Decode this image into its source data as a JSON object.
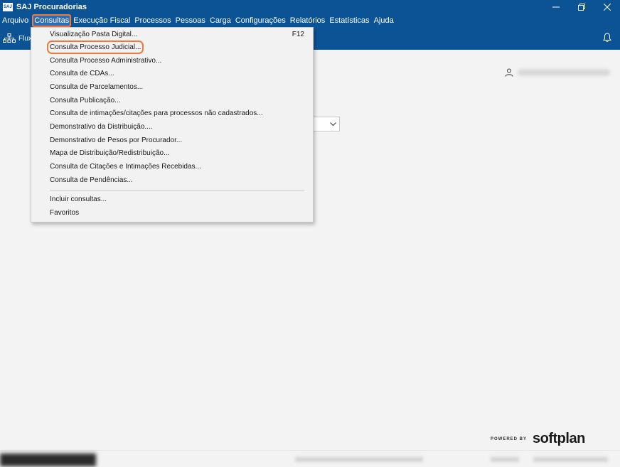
{
  "window": {
    "logo": "SAJ",
    "title": "SAJ Procuradorias"
  },
  "menubar": {
    "items": [
      "Arquivo",
      "Consultas",
      "Execução Fiscal",
      "Processos",
      "Pessoas",
      "Carga",
      "Configurações",
      "Relatórios",
      "Estatísticas",
      "Ajuda"
    ],
    "active_index": 1
  },
  "toolbar": {
    "first_item": "Flux",
    "icons": [
      "sitemap-icon",
      "bell-icon"
    ]
  },
  "consultas_menu": {
    "items": [
      {
        "label": "Visualização Pasta Digital...",
        "shortcut": "F12"
      },
      {
        "label": "Consulta Processo Judicial...",
        "highlighted": true
      },
      {
        "label": "Consulta Processo Administrativo..."
      },
      {
        "label": "Consulta de CDAs..."
      },
      {
        "label": "Consulta de Parcelamentos..."
      },
      {
        "label": "Consulta Publicação..."
      },
      {
        "label": "Consulta de intimações/citações para processos não cadastrados..."
      },
      {
        "label": "Demonstrativo da Distribuição...."
      },
      {
        "label": "Demonstrativo de Pesos por Procurador..."
      },
      {
        "label": "Mapa de Distribuição/Redistribuição..."
      },
      {
        "label": "Consulta de Citações e Intimações Recebidas..."
      },
      {
        "label": "Consulta de Pendências..."
      },
      {
        "label": "Incluir consultas..."
      },
      {
        "label": "Favoritos"
      }
    ]
  },
  "footer": {
    "powered_by": "POWERED BY",
    "brand": "softplan"
  },
  "colors": {
    "brand_blue": "#0b5394",
    "highlight_orange": "#f07a3c",
    "background": "#f3f3f3"
  }
}
